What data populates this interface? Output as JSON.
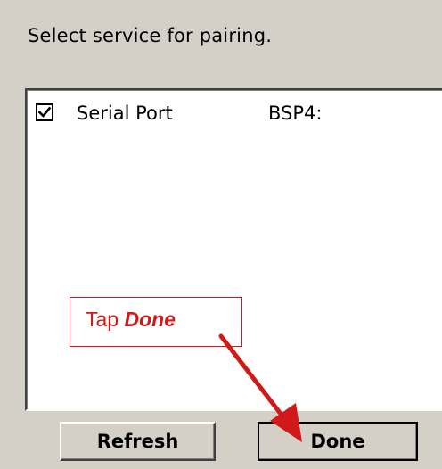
{
  "dialog": {
    "prompt": "Select service for pairing."
  },
  "services": [
    {
      "name": "Serial Port",
      "port": "BSP4:",
      "checked": true
    }
  ],
  "buttons": {
    "refresh_label": "Refresh",
    "done_label": "Done"
  },
  "callout": {
    "prefix": "Tap ",
    "emphasis": "Done",
    "color": "#d01a1a"
  },
  "colors": {
    "dialog_background": "#d4d0c8",
    "list_background": "#ffffff",
    "annotation_red": "#d01a1a"
  },
  "icons": {
    "checkbox": "checkmark-icon",
    "annotation_arrow": "arrow-icon"
  }
}
